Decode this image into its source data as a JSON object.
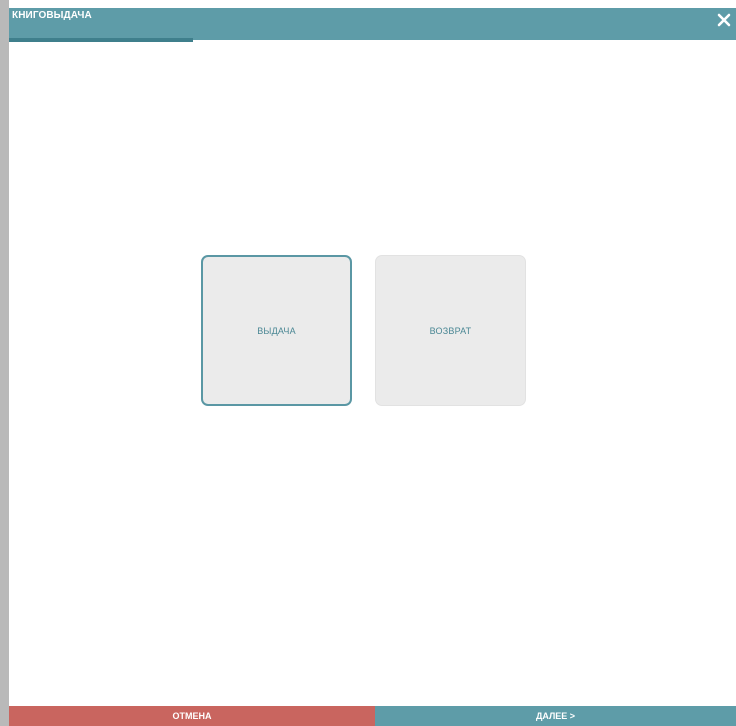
{
  "window": {
    "title": "КНИГОВЫДАЧА",
    "close_icon": "close-icon"
  },
  "options": [
    {
      "label": "ВЫДАЧА",
      "selected": true
    },
    {
      "label": "ВОЗВРАТ",
      "selected": false
    }
  ],
  "footer": {
    "cancel_label": "ОТМЕНА",
    "next_label": "ДАЛЕЕ >"
  },
  "colors": {
    "accent": "#5e9ca8",
    "cancel": "#c9655f",
    "tile_bg": "#ebebeb",
    "selected_border": "#5a97a4"
  }
}
